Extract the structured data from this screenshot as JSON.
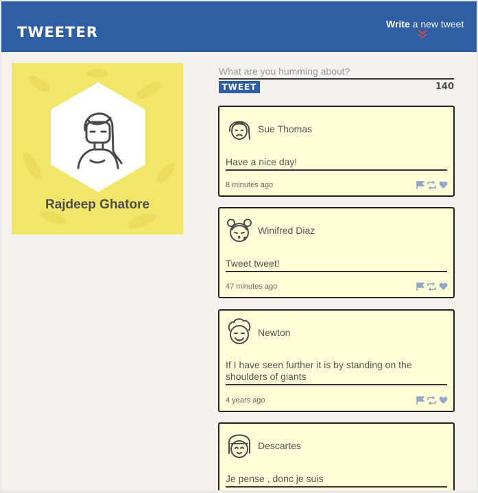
{
  "app": {
    "brand": "TWEETER"
  },
  "header": {
    "compose_bold": "Write",
    "compose_rest": "a new tweet"
  },
  "profile": {
    "name": "Rajdeep Ghatore"
  },
  "composer": {
    "placeholder": "What are you humming about?",
    "button_label": "TWEET",
    "counter": "140"
  },
  "tweets": [
    {
      "author": "Sue Thomas",
      "text": "Have a nice day!",
      "time": "8 minutes ago",
      "avatar": "woman-frown-avatar"
    },
    {
      "author": "Winifred Diaz",
      "text": "Tweet tweet!",
      "time": "47 minutes ago",
      "avatar": "girl-kiss-avatar"
    },
    {
      "author": "Newton",
      "text": "If I have seen further it is by standing on the shoulders of giants",
      "time": "4 years ago",
      "avatar": "curly-man-avatar"
    },
    {
      "author": "Descartes",
      "text": "Je pense , donc je suis",
      "time": "",
      "avatar": "bob-hair-avatar"
    }
  ],
  "colors": {
    "navbar": "#2f5ea3",
    "profile_bg": "#f1e66a",
    "tweet_bg": "#fffdd8",
    "icon": "#8fa7c9",
    "chevron": "#d94848"
  },
  "icons": {
    "flag": "flag-icon",
    "retweet": "retweet-icon",
    "like": "heart-icon",
    "compose": "chevron-down-icon"
  }
}
